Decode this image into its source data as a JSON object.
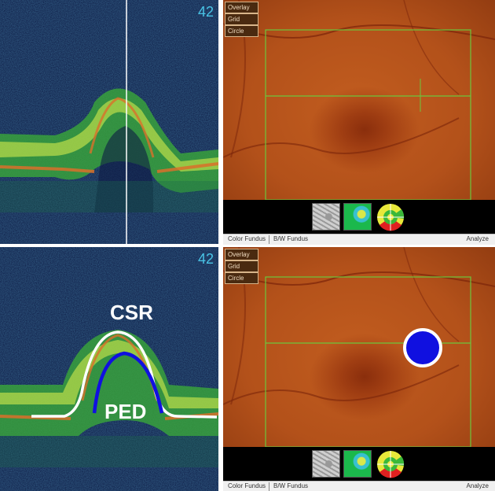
{
  "top_oct": {
    "number": "42"
  },
  "bottom_oct": {
    "number": "42",
    "labels": {
      "upper": "CSR",
      "lower": "PED"
    }
  },
  "fundus_menu": [
    "Overlay",
    "Grid",
    "Circle"
  ],
  "tabs": {
    "color_fundus": "Color Fundus",
    "bw_fundus": "B/W Fundus",
    "analyze": "Analyze"
  },
  "thumbnails": [
    "bw-fundus-thumbnail",
    "thickness-map-thumbnail",
    "sector-chart-thumbnail"
  ],
  "colors": {
    "grid_line": "#6cc63c",
    "marker": "#1010e0",
    "oct_label": "#49c4e6"
  }
}
